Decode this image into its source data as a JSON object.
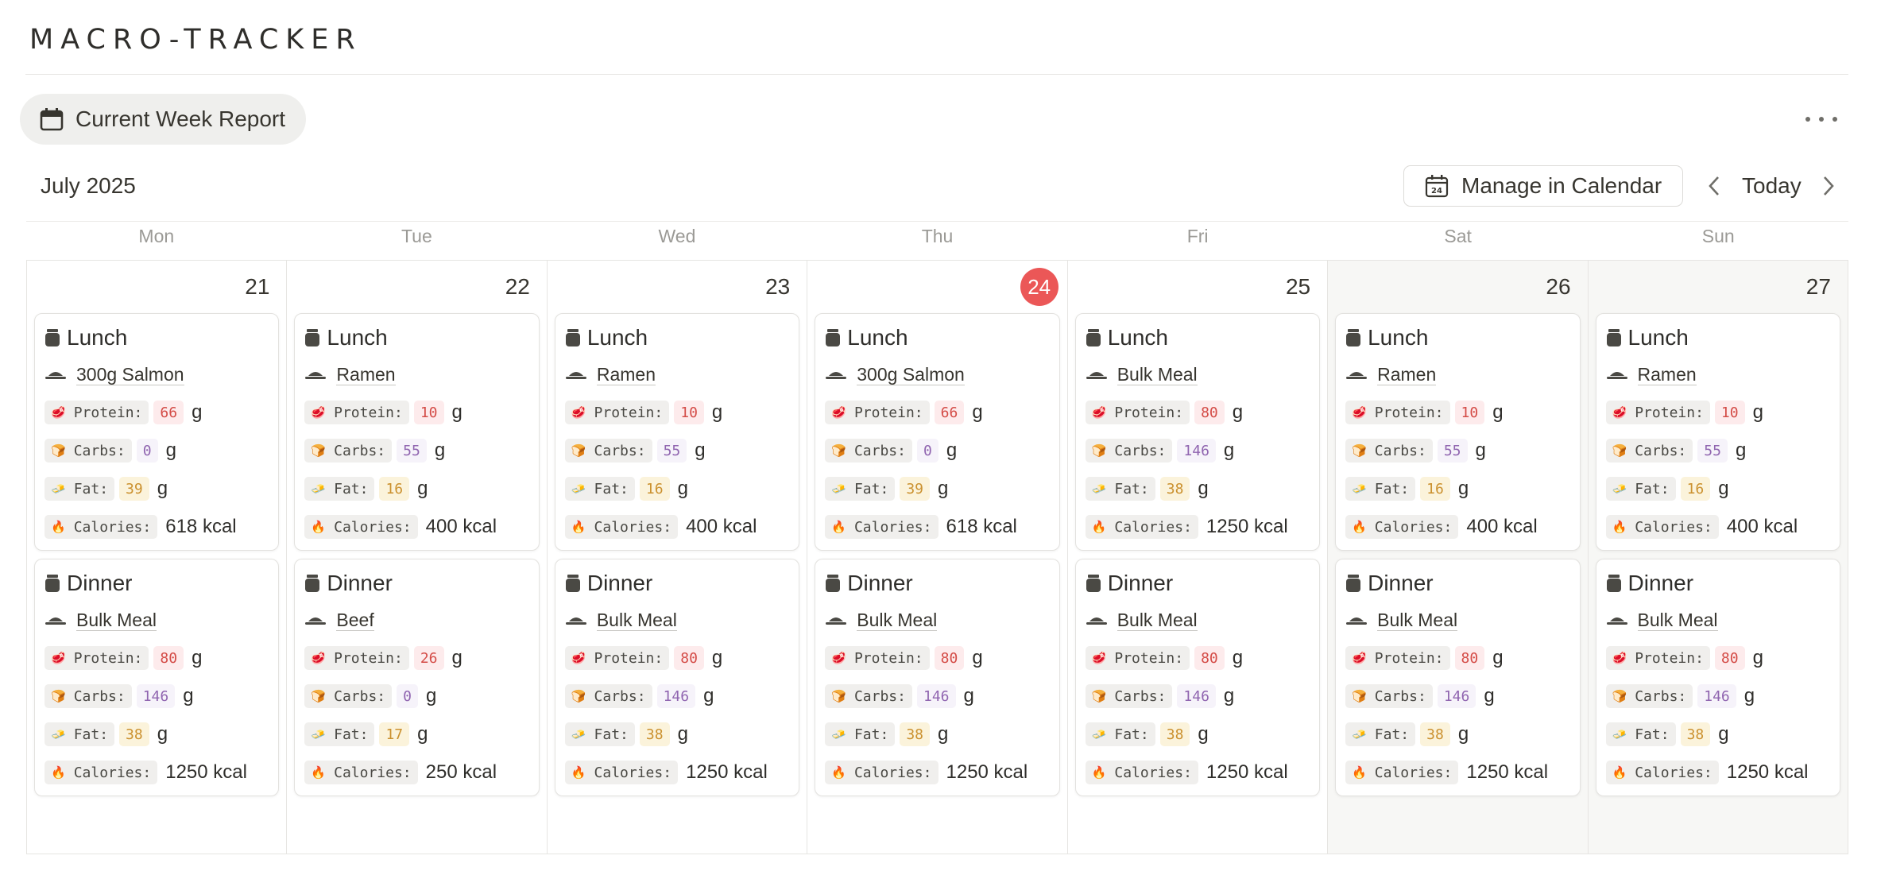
{
  "app": {
    "title": "MACRO-TRACKER"
  },
  "toolbar": {
    "view_tab_label": "Current Week Report",
    "month_label": "July 2025",
    "manage_label": "Manage in Calendar",
    "today_label": "Today"
  },
  "labels": {
    "protein": "Protein:",
    "carbs": "Carbs:",
    "fat": "Fat:",
    "calories": "Calories:",
    "gram_unit": "g",
    "kcal_unit": "kcal"
  },
  "colors": {
    "protein_bg": "#fdebec",
    "protein_fg": "#d44c47",
    "carbs_bg": "#f6f3fa",
    "carbs_fg": "#9065b0",
    "fat_bg": "#fbf3db",
    "fat_fg": "#cb912f",
    "today_badge": "#eb5757"
  },
  "icons": {
    "view_tab": "calendar-icon",
    "manage": "calendar-24-icon",
    "meal": "jar-icon",
    "food": "plate-icon",
    "protein": "meat-icon",
    "carbs": "bread-icon",
    "fat": "butter-icon",
    "calories": "fire-icon",
    "more": "ellipsis-icon",
    "prev": "chevron-left-icon",
    "next": "chevron-right-icon"
  },
  "week": {
    "days": [
      {
        "dow": "Mon",
        "date": "21",
        "today": false,
        "weekend": false,
        "meals": [
          {
            "meal": "Lunch",
            "food": "300g Salmon",
            "protein": "66",
            "carbs": "0",
            "fat": "39",
            "calories": "618"
          },
          {
            "meal": "Dinner",
            "food": "Bulk Meal",
            "protein": "80",
            "carbs": "146",
            "fat": "38",
            "calories": "1250"
          }
        ]
      },
      {
        "dow": "Tue",
        "date": "22",
        "today": false,
        "weekend": false,
        "meals": [
          {
            "meal": "Lunch",
            "food": "Ramen",
            "protein": "10",
            "carbs": "55",
            "fat": "16",
            "calories": "400"
          },
          {
            "meal": "Dinner",
            "food": "Beef",
            "protein": "26",
            "carbs": "0",
            "fat": "17",
            "calories": "250"
          }
        ]
      },
      {
        "dow": "Wed",
        "date": "23",
        "today": false,
        "weekend": false,
        "meals": [
          {
            "meal": "Lunch",
            "food": "Ramen",
            "protein": "10",
            "carbs": "55",
            "fat": "16",
            "calories": "400"
          },
          {
            "meal": "Dinner",
            "food": "Bulk Meal",
            "protein": "80",
            "carbs": "146",
            "fat": "38",
            "calories": "1250"
          }
        ]
      },
      {
        "dow": "Thu",
        "date": "24",
        "today": true,
        "weekend": false,
        "meals": [
          {
            "meal": "Lunch",
            "food": "300g Salmon",
            "protein": "66",
            "carbs": "0",
            "fat": "39",
            "calories": "618"
          },
          {
            "meal": "Dinner",
            "food": "Bulk Meal",
            "protein": "80",
            "carbs": "146",
            "fat": "38",
            "calories": "1250"
          }
        ]
      },
      {
        "dow": "Fri",
        "date": "25",
        "today": false,
        "weekend": false,
        "meals": [
          {
            "meal": "Lunch",
            "food": "Bulk Meal",
            "protein": "80",
            "carbs": "146",
            "fat": "38",
            "calories": "1250"
          },
          {
            "meal": "Dinner",
            "food": "Bulk Meal",
            "protein": "80",
            "carbs": "146",
            "fat": "38",
            "calories": "1250"
          }
        ]
      },
      {
        "dow": "Sat",
        "date": "26",
        "today": false,
        "weekend": true,
        "meals": [
          {
            "meal": "Lunch",
            "food": "Ramen",
            "protein": "10",
            "carbs": "55",
            "fat": "16",
            "calories": "400"
          },
          {
            "meal": "Dinner",
            "food": "Bulk Meal",
            "protein": "80",
            "carbs": "146",
            "fat": "38",
            "calories": "1250"
          }
        ]
      },
      {
        "dow": "Sun",
        "date": "27",
        "today": false,
        "weekend": true,
        "meals": [
          {
            "meal": "Lunch",
            "food": "Ramen",
            "protein": "10",
            "carbs": "55",
            "fat": "16",
            "calories": "400"
          },
          {
            "meal": "Dinner",
            "food": "Bulk Meal",
            "protein": "80",
            "carbs": "146",
            "fat": "38",
            "calories": "1250"
          }
        ]
      }
    ]
  }
}
